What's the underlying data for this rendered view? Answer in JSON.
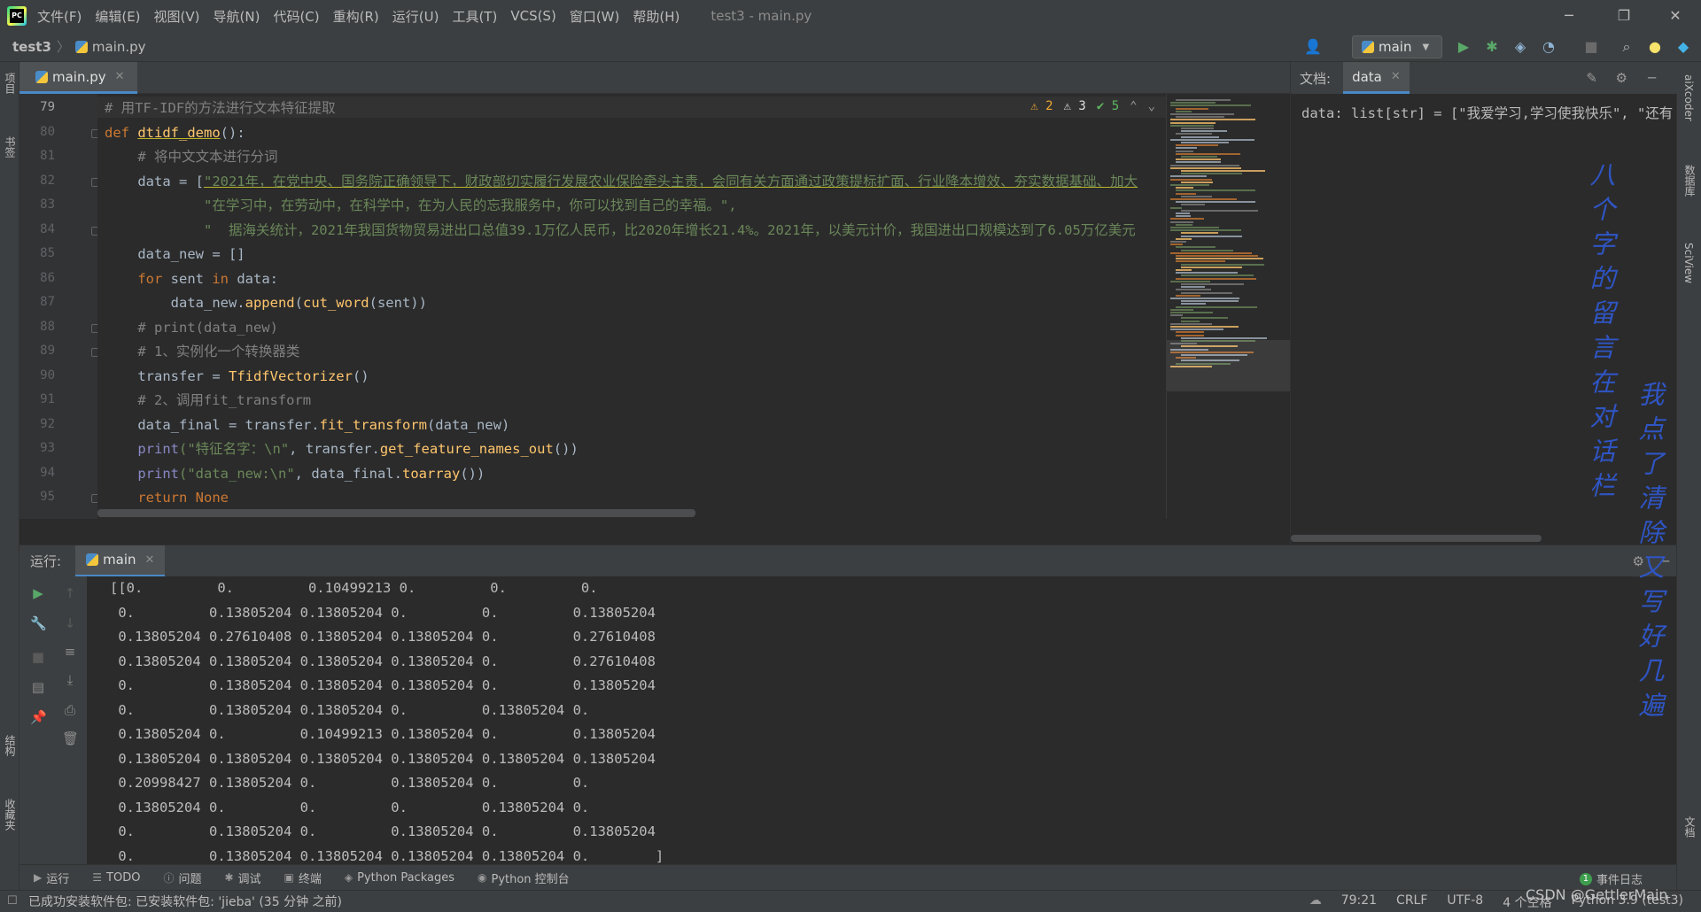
{
  "window": {
    "title": "test3 - main.py",
    "menu": [
      "文件(F)",
      "编辑(E)",
      "视图(V)",
      "导航(N)",
      "代码(C)",
      "重构(R)",
      "运行(U)",
      "工具(T)",
      "VCS(S)",
      "窗口(W)",
      "帮助(H)"
    ],
    "controls": {
      "minimize": "─",
      "restore": "❐",
      "close": "✕"
    }
  },
  "navbar": {
    "project": "test3",
    "separator": "〉",
    "file": "main.py",
    "run_config": "main"
  },
  "left_strip": {
    "project": "项目",
    "bookmarks": "书签",
    "structure": "结构",
    "favorites": "收藏夹"
  },
  "right_strip": {
    "aixcoder": "aiXcoder",
    "database": "数据库",
    "sciview": "SciView",
    "docs": "文档"
  },
  "editor": {
    "tab": "main.py",
    "inspections": {
      "warnings": "2",
      "weak_warnings": "3",
      "ok": "5"
    },
    "current_line": "79",
    "lines": [
      {
        "n": "79",
        "text": "# 用TF-IDF的方法进行文本特征提取"
      },
      {
        "n": "80",
        "kw": "def ",
        "fn": "dtidf_demo",
        "rest": "():"
      },
      {
        "n": "81",
        "text": "    # 将中文文本进行分词"
      },
      {
        "n": "82",
        "pre": "    data = [",
        "str": "\"2021年，在党中央、国务院正确领导下，财政部切实履行发展农业保险牵头主责，会同有关方面通过政策提标扩面、行业降本增效、夯实数据基础、加大"
      },
      {
        "n": "83",
        "str": "            \"在学习中，在劳动中，在科学中，在为人民的忘我服务中，你可以找到自己的幸福。\","
      },
      {
        "n": "84",
        "str": "            \"  据海关统计，2021年我国货物贸易进出口总值39.1万亿人民币，比2020年增长21.4%。2021年，以美元计价，我国进出口规模达到了6.05万亿美元"
      },
      {
        "n": "85",
        "text": "    data_new = []"
      },
      {
        "n": "86",
        "kw1": "    for",
        "mid": " sent ",
        "kw2": "in",
        "rest": " data:"
      },
      {
        "n": "87",
        "pre": "        data_new.",
        "call": "append",
        "mid": "(",
        "call2": "cut_word",
        "rest": "(sent))"
      },
      {
        "n": "88",
        "text": "    # print(data_new)"
      },
      {
        "n": "89",
        "text": "    # 1、实例化一个转换器类"
      },
      {
        "n": "90",
        "pre": "    transfer = ",
        "call": "TfidfVectorizer",
        "rest": "()"
      },
      {
        "n": "91",
        "text": "    # 2、调用fit_transform"
      },
      {
        "n": "92",
        "pre": "    data_final = transfer.",
        "call": "fit_transform",
        "rest": "(data_new)"
      },
      {
        "n": "93",
        "bi": "    print",
        "str": "(\"特征名字：\\n\"",
        "pre": ", transfer.",
        "call": "get_feature_names_out",
        "rest": "())"
      },
      {
        "n": "94",
        "bi": "    print",
        "str": "(\"data_new:\\n\"",
        "pre": ", data_final.",
        "call": "toarray",
        "rest": "())"
      },
      {
        "n": "95",
        "kw": "    return ",
        "kw2": "None"
      }
    ]
  },
  "doc": {
    "label": "文档:",
    "tab": "data",
    "content": "data: list[str] = [\"我爱学习,学习使我快乐\", \"还有比"
  },
  "run": {
    "label": "运行:",
    "tab": "main",
    "output": [
      "[[0.         0.         0.10499213 0.         0.         0.",
      " 0.         0.13805204 0.13805204 0.         0.         0.13805204",
      " 0.13805204 0.27610408 0.13805204 0.13805204 0.         0.27610408",
      " 0.13805204 0.13805204 0.13805204 0.13805204 0.         0.27610408",
      " 0.         0.13805204 0.13805204 0.13805204 0.         0.13805204",
      " 0.         0.13805204 0.13805204 0.         0.13805204 0.",
      " 0.13805204 0.         0.10499213 0.13805204 0.         0.13805204",
      " 0.13805204 0.13805204 0.13805204 0.13805204 0.13805204 0.13805204",
      " 0.20998427 0.13805204 0.         0.13805204 0.         0.",
      " 0.13805204 0.         0.         0.         0.13805204 0.",
      " 0.         0.13805204 0.         0.13805204 0.         0.13805204",
      " 0.         0.13805204 0.13805204 0.13805204 0.13805204 0.        ]"
    ]
  },
  "tool_tabs": [
    "运行",
    "TODO",
    "问题",
    "调试",
    "终端",
    "Python Packages",
    "Python 控制台"
  ],
  "event_log": {
    "count": "1",
    "label": "事件日志"
  },
  "status": {
    "message": "已成功安装软件包: 已安装软件包: 'jieba' (35 分钟 之前)",
    "position": "79:21",
    "line_sep": "CRLF",
    "encoding": "UTF-8",
    "indent": "4 个空格",
    "interpreter": "Python 3.9 (test3)"
  },
  "annotation": {
    "column1": "八个字的留言在对话栏",
    "column2": "我点了清除又写好几遍"
  },
  "watermark": "CSDN @GettlerMain",
  "colors": {
    "accent": "#4a88c7",
    "comment": "#808080",
    "keyword": "#cc7832",
    "string": "#6a8759",
    "function": "#ffc66d",
    "annotation": "#2f55c4"
  }
}
